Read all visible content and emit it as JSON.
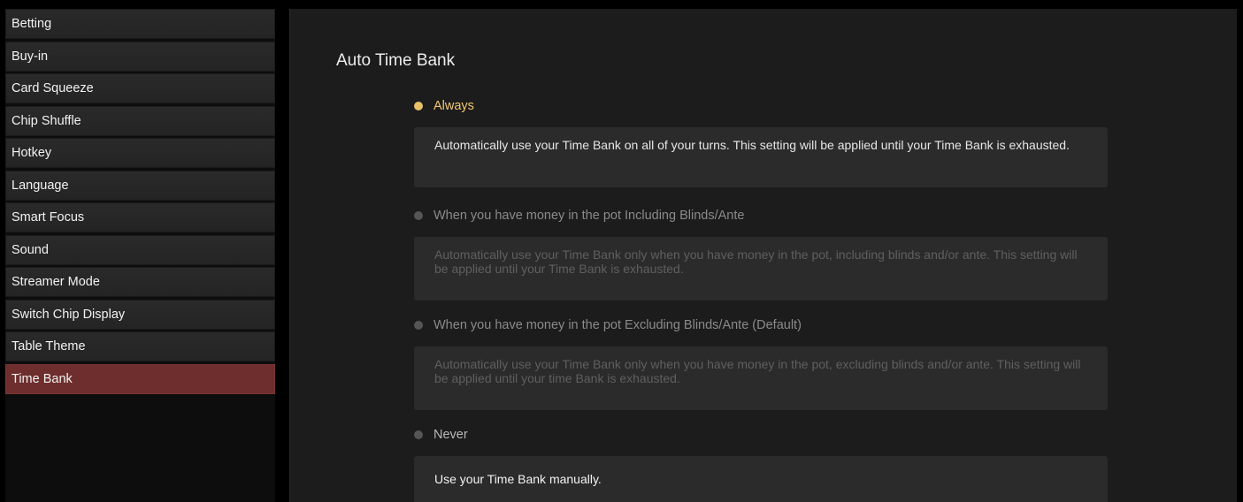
{
  "sidebar": {
    "items": [
      {
        "label": "Betting",
        "active": false
      },
      {
        "label": "Buy-in",
        "active": false
      },
      {
        "label": "Card Squeeze",
        "active": false
      },
      {
        "label": "Chip Shuffle",
        "active": false
      },
      {
        "label": "Hotkey",
        "active": false
      },
      {
        "label": "Language",
        "active": false
      },
      {
        "label": "Smart Focus",
        "active": false
      },
      {
        "label": "Sound",
        "active": false
      },
      {
        "label": "Streamer Mode",
        "active": false
      },
      {
        "label": "Switch Chip Display",
        "active": false
      },
      {
        "label": "Table Theme",
        "active": false
      },
      {
        "label": "Time Bank",
        "active": true
      }
    ]
  },
  "main": {
    "title": "Auto Time Bank",
    "options": [
      {
        "label": "Always",
        "description": "Automatically use your Time Bank on all of your turns. This setting will be applied until your Time Bank is exhausted.",
        "selected": true
      },
      {
        "label": "When you have money in the pot Including Blinds/Ante",
        "description": "Automatically use your Time Bank only when you have money in the pot, including blinds and/or ante. This setting will be applied until your Time Bank is exhausted.",
        "selected": false
      },
      {
        "label": "When you have money in the pot Excluding Blinds/Ante (Default)",
        "description": "Automatically use your Time Bank only when you have money in the pot, excluding blinds and/or ante. This setting will be applied until your time Bank is exhausted.",
        "selected": false
      },
      {
        "label": "Never",
        "description": "Use your Time Bank manually.",
        "selected": false
      }
    ]
  },
  "colors": {
    "accent": "#f0c96e",
    "active_item": "#6e2e2e",
    "panel": "#1c1c1c",
    "desc_box": "#2b2b2b"
  }
}
